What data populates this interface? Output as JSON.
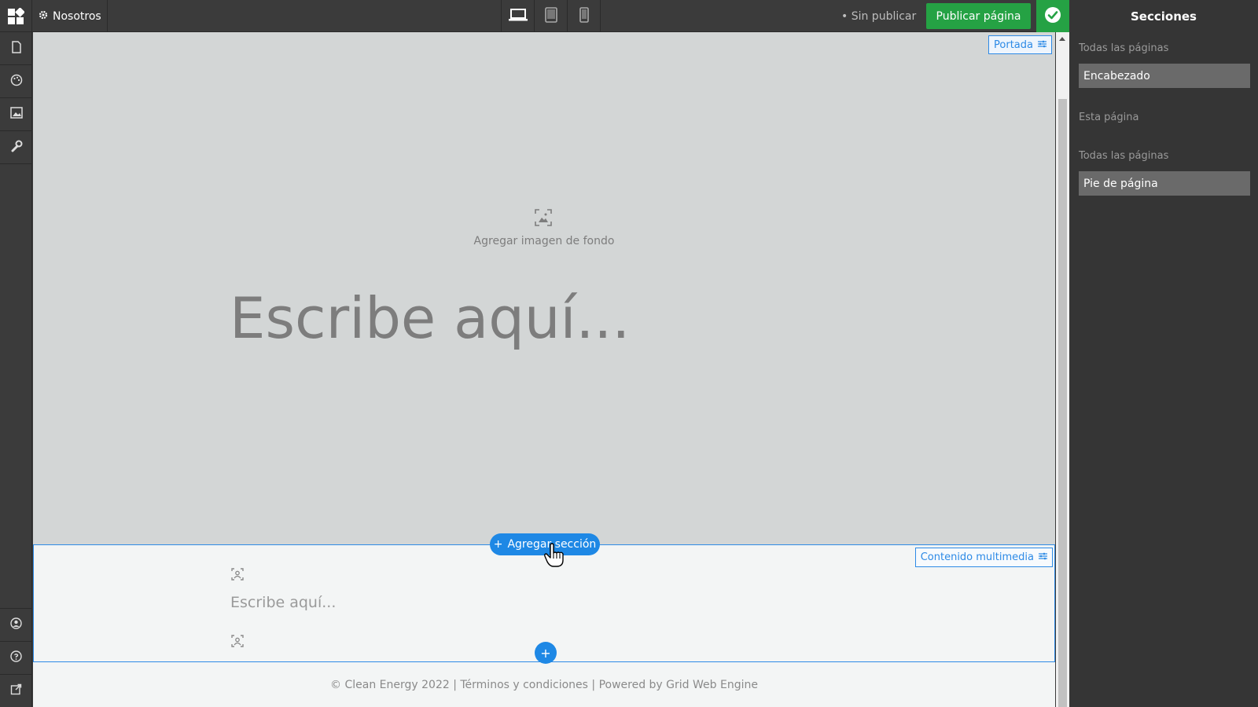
{
  "topbar": {
    "page_name": "Nosotros",
    "status": "• Sin publicar",
    "publish_label": "Publicar página"
  },
  "panel": {
    "title": "Secciones",
    "group1_label": "Todas las páginas",
    "header_item": "Encabezado",
    "group2_label": "Esta página",
    "group3_label": "Todas las páginas",
    "footer_item": "Pie de página"
  },
  "canvas": {
    "hero_badge": "Portada",
    "bg_text": "Agregar imagen de fondo",
    "hero_title": "Escribe aquí...",
    "add_section": "Agregar sección",
    "media_badge": "Contenido multimedia",
    "media_text": "Escribe aquí...",
    "footer_text": "© Clean Energy 2022 | Términos y condiciones | Powered by Grid Web Engine"
  },
  "colors": {
    "accent": "#1e88e5",
    "publish": "#25a244"
  },
  "icons": [
    "grid-logo-icon",
    "gear-icon",
    "desktop-icon",
    "tablet-icon",
    "phone-icon",
    "check-icon",
    "page-icon",
    "palette-icon",
    "image-icon",
    "wrench-icon",
    "user-icon",
    "help-icon",
    "external-link-icon",
    "sliders-icon",
    "add-image-icon",
    "media-icon",
    "plus-icon",
    "hand-cursor-icon"
  ]
}
